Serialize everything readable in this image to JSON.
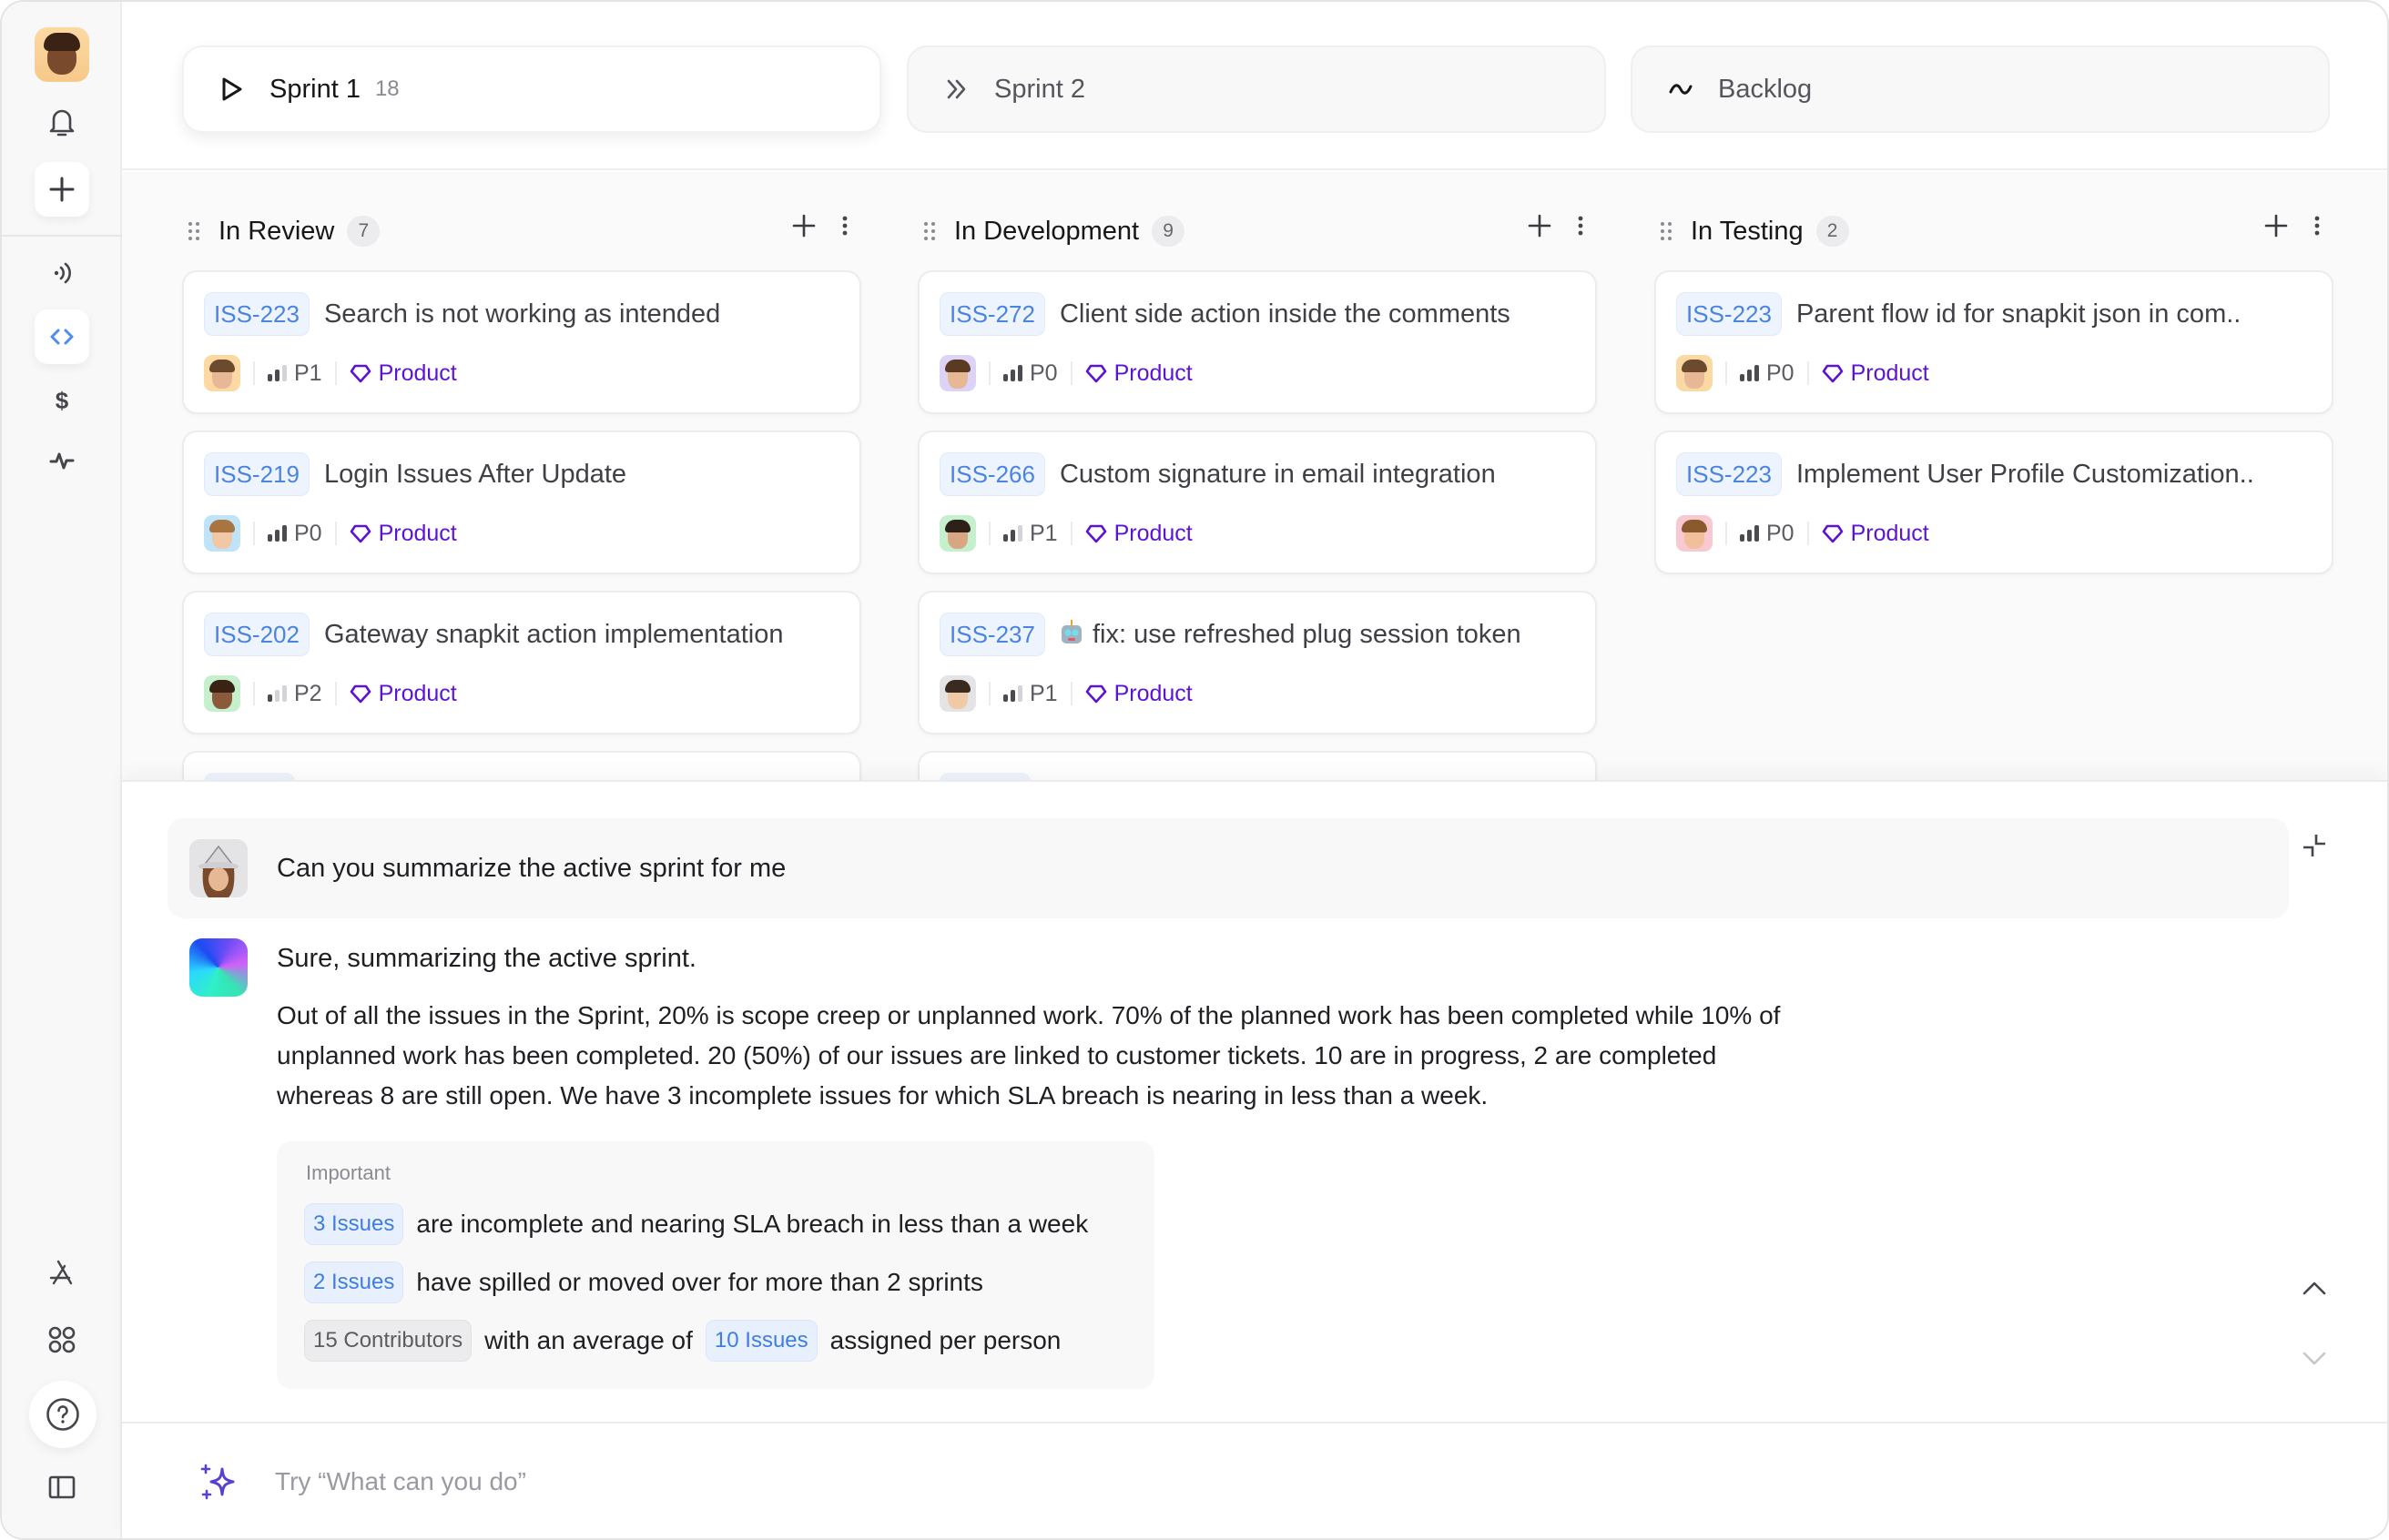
{
  "sidebar": {
    "items": [
      {
        "name": "profile-avatar",
        "icon": "memoji-avatar"
      },
      {
        "name": "notifications",
        "icon": "bell-icon"
      },
      {
        "name": "create",
        "icon": "plus-icon"
      },
      {
        "name": "broadcast",
        "icon": "signal-icon"
      },
      {
        "name": "code",
        "icon": "code-icon",
        "active": true
      },
      {
        "name": "billing",
        "icon": "dollar-icon"
      },
      {
        "name": "activity",
        "icon": "pulse-icon"
      },
      {
        "name": "app-store",
        "icon": "app-store-icon"
      },
      {
        "name": "apps",
        "icon": "grid-icon"
      },
      {
        "name": "help",
        "icon": "help-icon"
      },
      {
        "name": "toggle-panel",
        "icon": "sidebar-toggle-icon"
      }
    ]
  },
  "sprints": {
    "tabs": [
      {
        "label": "Sprint 1",
        "count": "18",
        "icon": "play-icon",
        "active": true
      },
      {
        "label": "Sprint 2",
        "icon": "double-chevron-right-icon",
        "active": false
      },
      {
        "label": "Backlog",
        "icon": "tilde-icon",
        "active": false
      }
    ]
  },
  "board": {
    "columns": [
      {
        "title": "In Review",
        "count": "7",
        "cards": [
          {
            "id": "ISS-223",
            "title": "Search is not working as intended",
            "priority": "P1",
            "priority_level": 2,
            "tag": "Product",
            "avatar_bg": "#fcd9a2"
          },
          {
            "id": "ISS-219",
            "title": "Login Issues After Update",
            "priority": "P0",
            "priority_level": 3,
            "tag": "Product",
            "avatar_bg": "#bfe3f7"
          },
          {
            "id": "ISS-202",
            "title": "Gateway snapkit action implementation",
            "priority": "P2",
            "priority_level": 1,
            "tag": "Product",
            "avatar_bg": "#c5efcd"
          }
        ]
      },
      {
        "title": "In Development",
        "count": "9",
        "cards": [
          {
            "id": "ISS-272",
            "title": "Client side action inside the comments",
            "priority": "P0",
            "priority_level": 3,
            "tag": "Product",
            "avatar_bg": "#ddd3f6"
          },
          {
            "id": "ISS-266",
            "title": "Custom signature in email integration",
            "priority": "P1",
            "priority_level": 2,
            "tag": "Product",
            "avatar_bg": "#c5efcd"
          },
          {
            "id": "ISS-237",
            "title": "fix: use refreshed plug session token",
            "robot_emoji": true,
            "priority": "P1",
            "priority_level": 2,
            "tag": "Product",
            "avatar_bg": "#e4e4e7"
          }
        ]
      },
      {
        "title": "In Testing",
        "count": "2",
        "cards": [
          {
            "id": "ISS-223",
            "title": "Parent flow id for snapkit json in com..",
            "priority": "P0",
            "priority_level": 3,
            "tag": "Product",
            "avatar_bg": "#fcd9a2"
          },
          {
            "id": "ISS-223",
            "title": "Implement User Profile Customization..",
            "priority": "P0",
            "priority_level": 3,
            "tag": "Product",
            "avatar_bg": "#f9c9d2"
          }
        ]
      }
    ]
  },
  "chat": {
    "user_message": "Can you summarize the active sprint for me",
    "bot_intro": "Sure, summarizing the active sprint.",
    "bot_paragraph": "Out of all the issues in the Sprint, 20% is scope creep or unplanned work. 70% of the planned work has been completed while 10% of unplanned work has been completed. 20 (50%) of our issues are linked to customer tickets. 10 are in progress, 2 are completed whereas 8 are still open. We have 3 incomplete issues for which SLA breach is nearing in less than a week.",
    "important": {
      "label": "Important",
      "rows": [
        {
          "chip": "3 Issues",
          "text": "are incomplete and nearing SLA breach in less than a week"
        },
        {
          "chip": "2 Issues",
          "text": "have spilled or moved over for more than 2 sprints"
        },
        {
          "chip": "15 Contributors",
          "text": "with an average of",
          "chip2": "10 Issues",
          "text2": "assigned per person"
        }
      ]
    },
    "composer_placeholder": "Try “What can you do”"
  },
  "colors": {
    "accent_blue": "#4a84e0",
    "tag_purple": "#5b14d6",
    "spark_purple": "#5b3fd1"
  }
}
